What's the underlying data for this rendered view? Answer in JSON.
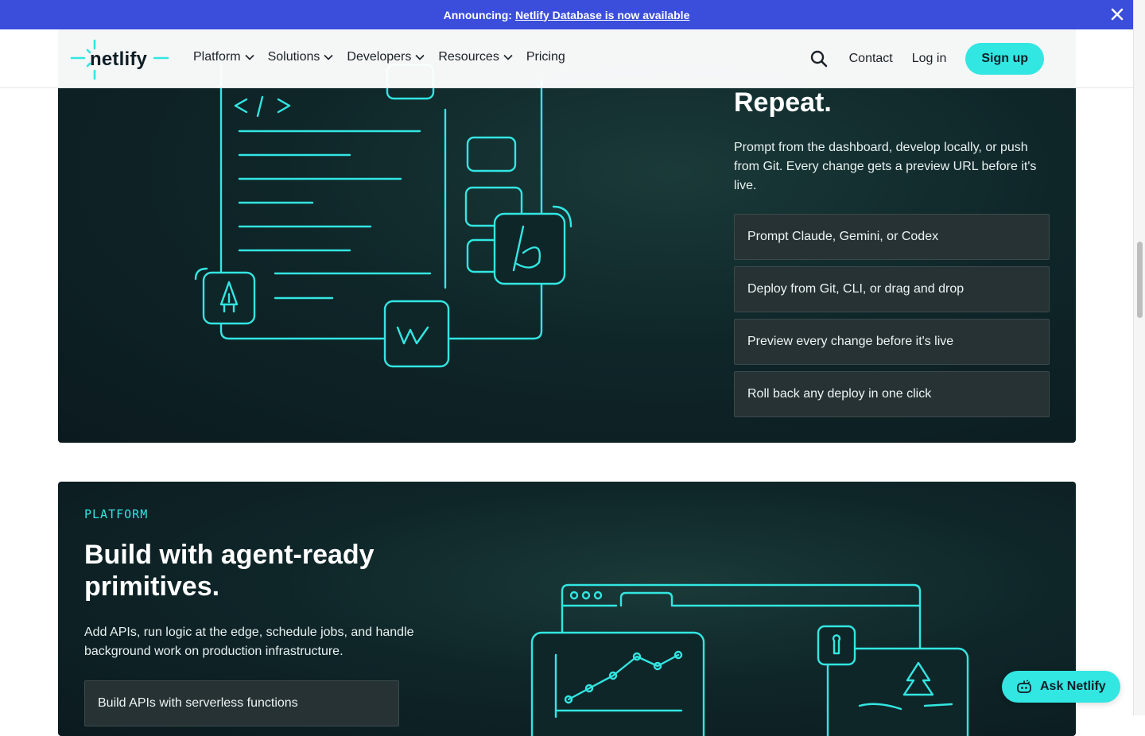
{
  "announcement": {
    "prefix": "Announcing:",
    "link": "Netlify Database is now available"
  },
  "nav": {
    "logo": "netlify",
    "menu": [
      {
        "label": "Platform"
      },
      {
        "label": "Solutions"
      },
      {
        "label": "Developers"
      },
      {
        "label": "Resources"
      },
      {
        "label": "Pricing"
      }
    ],
    "contact": "Contact",
    "login": "Log in",
    "signup": "Sign up"
  },
  "section1": {
    "title": "Repeat.",
    "description": "Prompt from the dashboard, develop locally, or push from Git. Every change gets a preview URL before it's live.",
    "features": [
      "Prompt Claude, Gemini, or Codex",
      "Deploy from Git, CLI, or drag and drop",
      "Preview every change before it's live",
      "Roll back any deploy in one click"
    ],
    "code_glyph": "</>"
  },
  "section2": {
    "eyebrow": "PLATFORM",
    "title": "Build with agent-ready primitives.",
    "description": "Add APIs, run logic at the edge, schedule jobs, and handle background work on production infrastructure.",
    "feature": "Build APIs with serverless functions"
  },
  "ask": {
    "label": "Ask Netlify"
  },
  "colors": {
    "accent": "#32e6e2",
    "banner": "#3a4ddb",
    "card_bg": "#0f2629"
  }
}
